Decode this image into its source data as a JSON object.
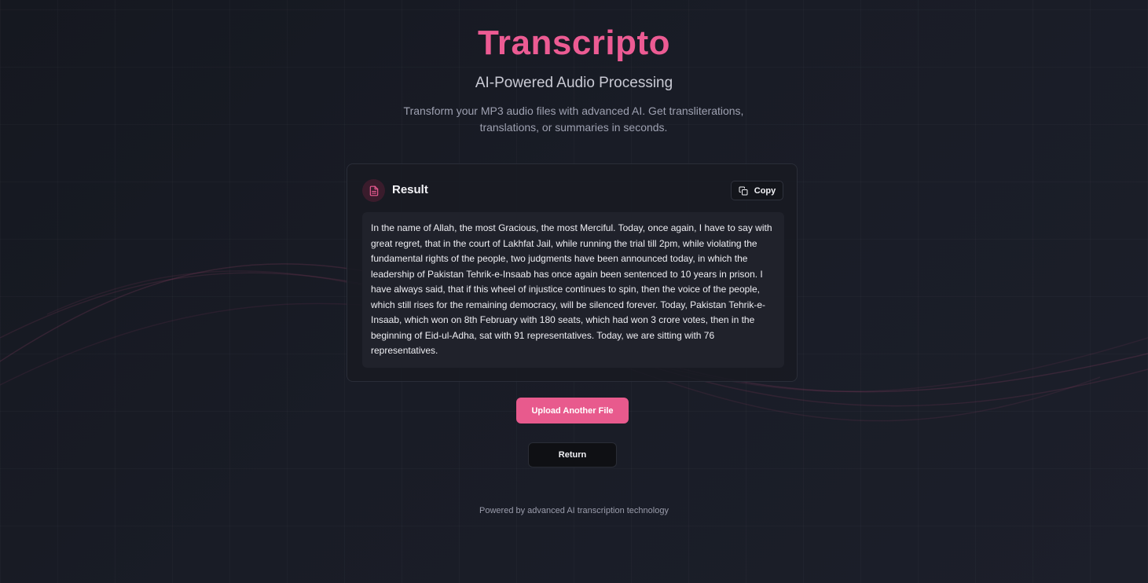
{
  "header": {
    "title": "Transcripto",
    "subtitle": "AI-Powered Audio Processing",
    "description": "Transform your MP3 audio files with advanced AI. Get transliterations, translations, or summaries in seconds."
  },
  "result_card": {
    "title": "Result",
    "icon": "document-icon",
    "copy_label": "Copy",
    "copy_icon": "copy-icon",
    "text": "In the name of Allah, the most Gracious, the most Merciful. Today, once again, I have to say with great regret, that in the court of Lakhfat Jail, while running the trial till 2pm, while violating the fundamental rights of the people, two judgments have been announced today, in which the leadership of Pakistan Tehrik-e-Insaab has once again been sentenced to 10 years in prison. I have always said, that if this wheel of injustice continues to spin, then the voice of the people, which still rises for the remaining democracy, will be silenced forever. Today, Pakistan Tehrik-e-Insaab, which won on 8th February with 180 seats, which had won 3 crore votes, then in the beginning of Eid-ul-Adha, sat with 91 representatives. Today, we are sitting with 76 representatives."
  },
  "actions": {
    "upload_label": "Upload Another File",
    "return_label": "Return"
  },
  "footer": {
    "text": "Powered by advanced AI transcription technology"
  },
  "colors": {
    "accent": "#ec5b93",
    "button_primary": "#e85a8d",
    "background": "#191c26"
  }
}
